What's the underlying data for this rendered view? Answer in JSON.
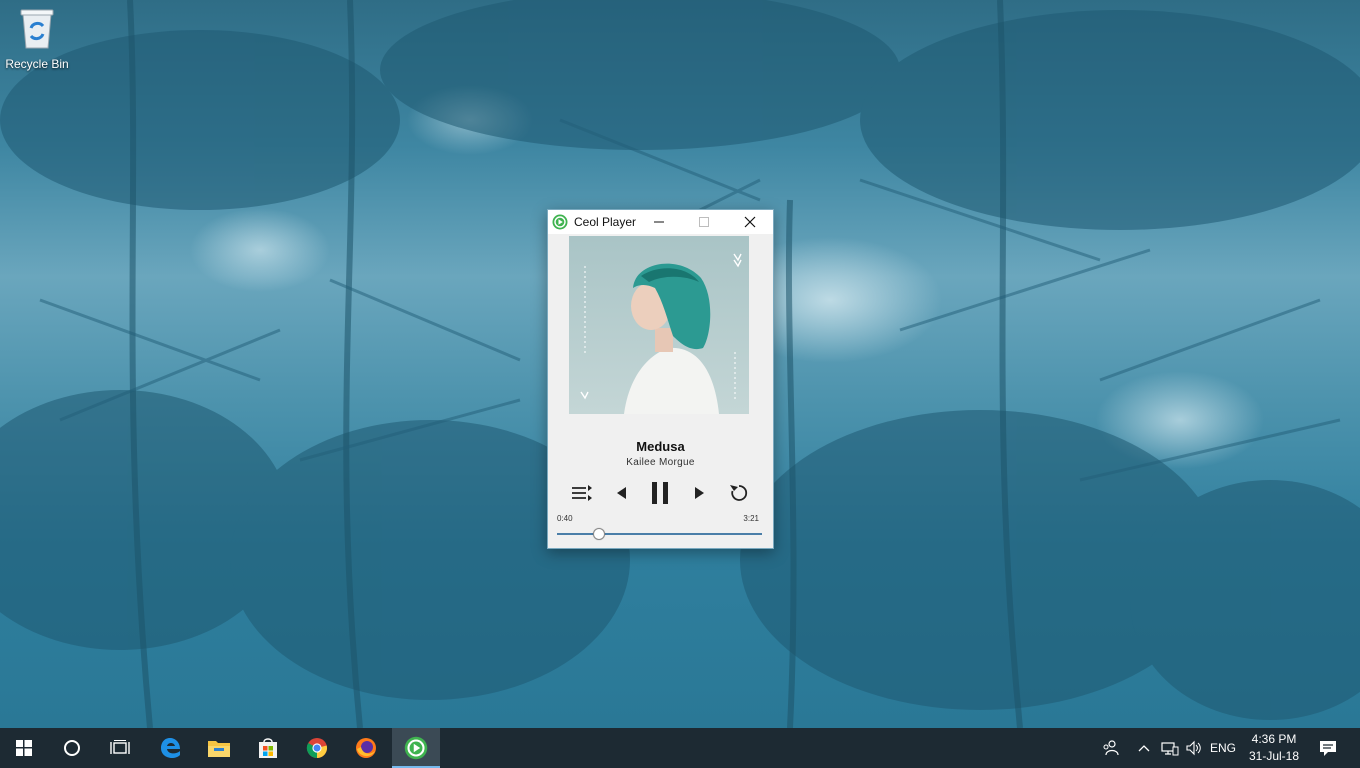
{
  "desktop": {
    "icons": [
      {
        "label": "Recycle Bin",
        "icon": "recycle-bin-icon"
      }
    ]
  },
  "player": {
    "title": "Ceol Player",
    "song": "Medusa",
    "artist": "Kailee Morgue",
    "time_current": "0:40",
    "time_total": "3:21",
    "progress_fraction": 0.2,
    "accent_color": "#4a7ea8",
    "app_icon_color": "#3fb34f",
    "controls": [
      {
        "name": "playlist",
        "icon": "playlist-icon"
      },
      {
        "name": "previous",
        "icon": "previous-icon"
      },
      {
        "name": "pause",
        "icon": "pause-icon"
      },
      {
        "name": "next",
        "icon": "next-icon"
      },
      {
        "name": "repeat",
        "icon": "repeat-icon"
      }
    ]
  },
  "taskbar": {
    "apps": [
      {
        "name": "start",
        "icon": "windows-start-icon"
      },
      {
        "name": "cortana",
        "icon": "cortana-circle-icon"
      },
      {
        "name": "task-view",
        "icon": "task-view-icon"
      },
      {
        "name": "edge",
        "icon": "edge-icon"
      },
      {
        "name": "file-explorer",
        "icon": "folder-icon"
      },
      {
        "name": "store",
        "icon": "store-icon"
      },
      {
        "name": "chrome",
        "icon": "chrome-icon"
      },
      {
        "name": "firefox",
        "icon": "firefox-icon"
      },
      {
        "name": "ceol-player",
        "icon": "ceol-player-icon",
        "active": true
      }
    ],
    "tray": {
      "language": "ENG",
      "time": "4:36 PM",
      "date": "31-Jul-18"
    }
  }
}
